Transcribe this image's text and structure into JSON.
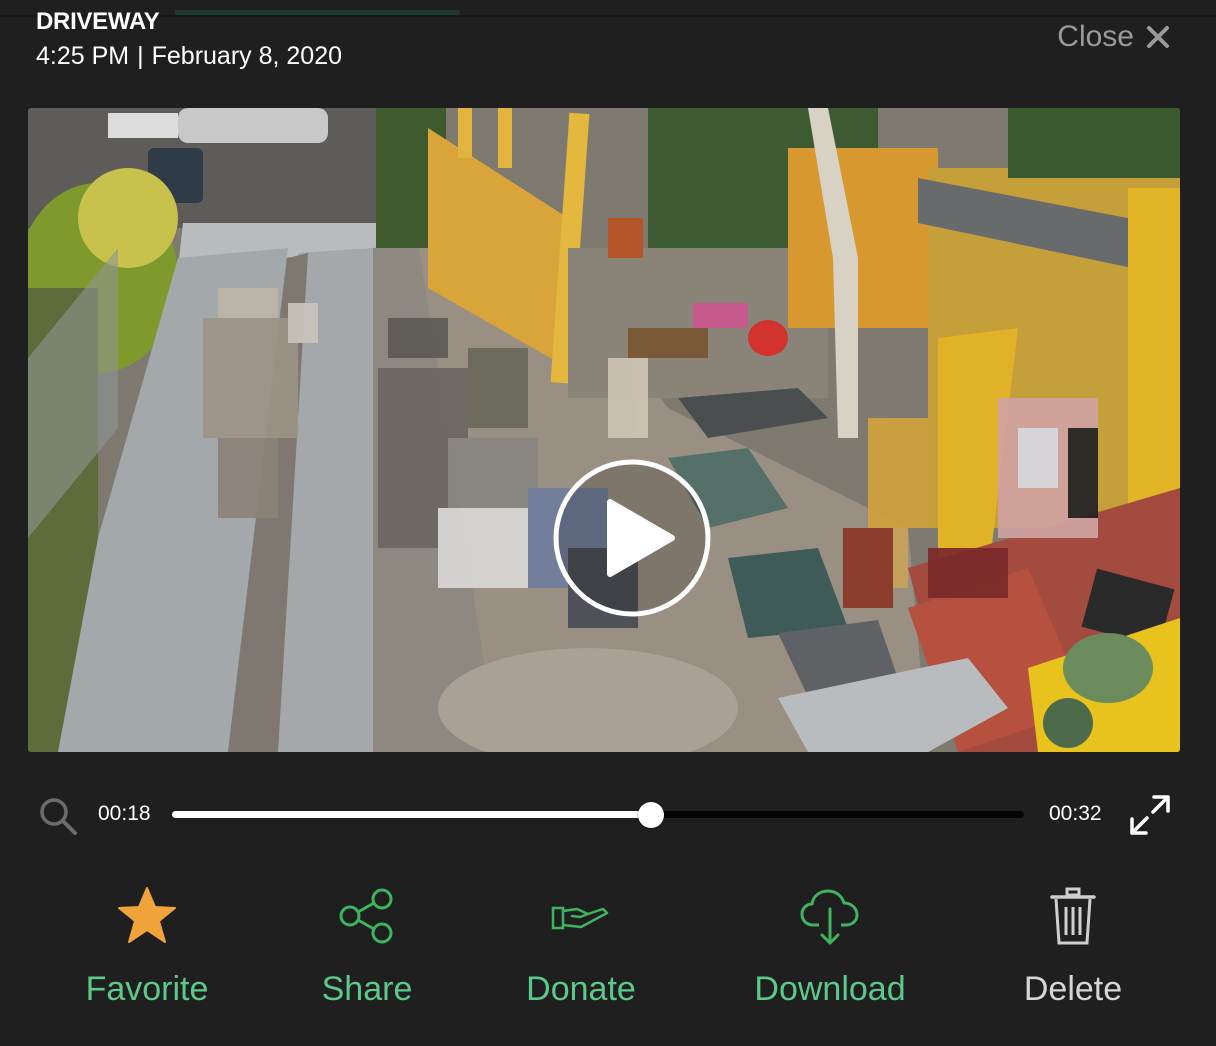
{
  "header": {
    "camera_name": "DRIVEWAY",
    "time": "4:25 PM",
    "separator": "|",
    "date": "February 8, 2020"
  },
  "close": {
    "label": "Close",
    "icon": "close-icon"
  },
  "video": {
    "state": "paused",
    "play_icon": "play-icon"
  },
  "player": {
    "current_time": "00:18",
    "duration": "00:32",
    "progress_fraction": 0.5625,
    "zoom_icon": "search-icon",
    "fullscreen_icon": "expand-icon"
  },
  "actions": [
    {
      "label": "Favorite",
      "icon": "star-icon",
      "color": "#f0a33a"
    },
    {
      "label": "Share",
      "icon": "share-icon",
      "color": "#3fb35f"
    },
    {
      "label": "Donate",
      "icon": "donate-hand-icon",
      "color": "#3fb35f"
    },
    {
      "label": "Download",
      "icon": "cloud-download-icon",
      "color": "#3fb35f"
    },
    {
      "label": "Delete",
      "icon": "trash-icon",
      "color": "#cfcfcf"
    }
  ],
  "colors": {
    "background": "#1f1f1f",
    "accent_green": "#3fb35f",
    "favorite_orange": "#f0a33a",
    "label_green": "#5cc98a",
    "muted": "#9a9a9a"
  }
}
